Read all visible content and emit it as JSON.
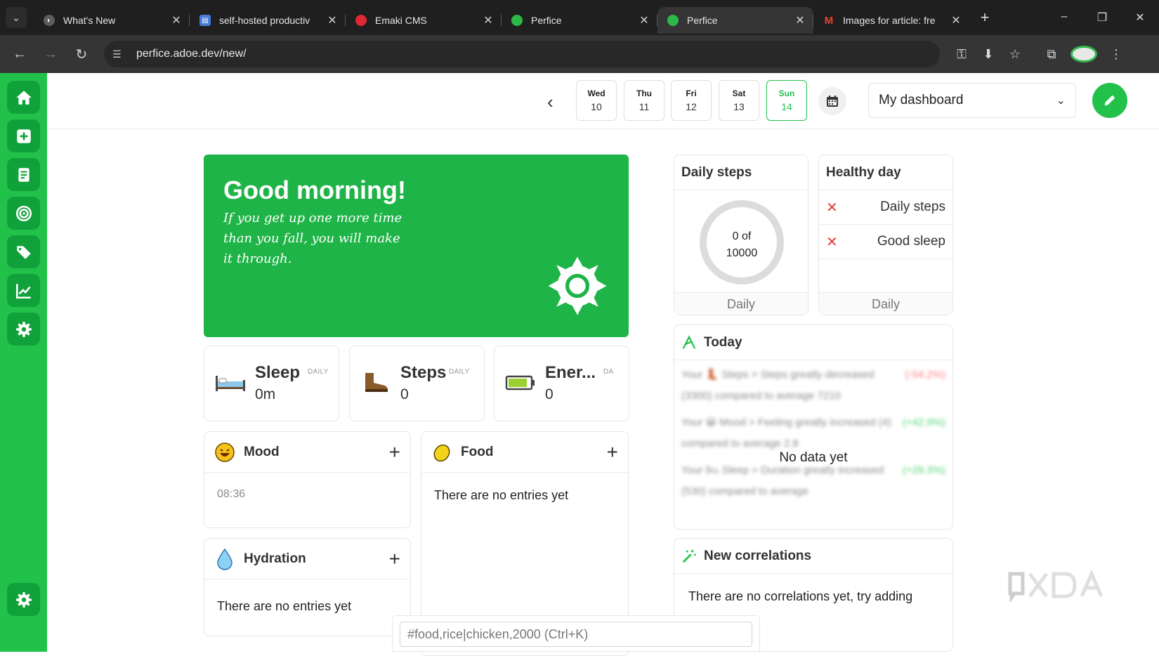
{
  "browser": {
    "tabs": [
      {
        "title": "What's New",
        "fav_color": "#d0d0d0",
        "fav_glyph": "◐"
      },
      {
        "title": "self-hosted productiv",
        "fav_color": "#4a7bd8",
        "fav_glyph": "▤"
      },
      {
        "title": "Emaki CMS",
        "fav_color": "#e02835",
        "fav_glyph": "◉"
      },
      {
        "title": "Perfice",
        "fav_color": "#2fb84a",
        "fav_glyph": "●"
      },
      {
        "title": "Perfice",
        "fav_color": "#2fb84a",
        "fav_glyph": "●"
      },
      {
        "title": "Images for article: fre",
        "fav_color": "#ea4335",
        "fav_glyph": "M"
      }
    ],
    "url": "perfice.adoe.dev/new/"
  },
  "topbar": {
    "days": [
      {
        "name": "Wed",
        "date": "10"
      },
      {
        "name": "Thu",
        "date": "11"
      },
      {
        "name": "Fri",
        "date": "12"
      },
      {
        "name": "Sat",
        "date": "13"
      },
      {
        "name": "Sun",
        "date": "14"
      }
    ],
    "selected_day": "Sun",
    "dashboard": "My dashboard"
  },
  "hero": {
    "greeting": "Good morning!",
    "quote": "If you get up one more time than you fall, you will make it through."
  },
  "metrics": [
    {
      "name": "Sleep",
      "tag": "DAILY",
      "value": "0m",
      "icon": "bed-icon"
    },
    {
      "name": "Steps",
      "tag": "DAILY",
      "value": "0",
      "icon": "boot-icon"
    },
    {
      "name": "Ener...",
      "tag": "DA",
      "value": "0",
      "icon": "battery-icon"
    }
  ],
  "panels": {
    "mood": {
      "title": "Mood",
      "entry": "08:36"
    },
    "food": {
      "title": "Food",
      "empty": "There are no entries yet"
    },
    "hydration": {
      "title": "Hydration",
      "empty": "There are no entries yet"
    }
  },
  "widgets": {
    "daily_steps": {
      "title": "Daily steps",
      "ring_line1": "0 of",
      "ring_line2": "10000",
      "footer": "Daily",
      "progress": 0
    },
    "healthy_day": {
      "title": "Healthy day",
      "rows": [
        "Daily steps",
        "Good sleep"
      ],
      "footer": "Daily"
    },
    "today": {
      "title": "Today",
      "no_data": "No data yet",
      "rows": [
        {
          "text": "Your 👢 Steps > Steps greatly decreased (3300) compared to average 7210",
          "delta": "(-54.2%)"
        },
        {
          "text": "Your 😀 Mood > Feeling greatly increased (4) compared to average 2.8",
          "delta": "(+42.9%)"
        },
        {
          "text": "Your 🛏 Sleep > Duration greatly increased (530) compared to average",
          "delta": "(+29.3%)"
        }
      ]
    },
    "correlations": {
      "title": "New correlations",
      "text": "There are no correlations yet, try adding"
    }
  },
  "command": {
    "placeholder": "#food,rice|chicken,2000 (Ctrl+K)"
  },
  "colors": {
    "brand": "#22c24a",
    "sidebar_btn": "#11a13a",
    "hero": "#1fb447",
    "error": "#e03c3c"
  }
}
